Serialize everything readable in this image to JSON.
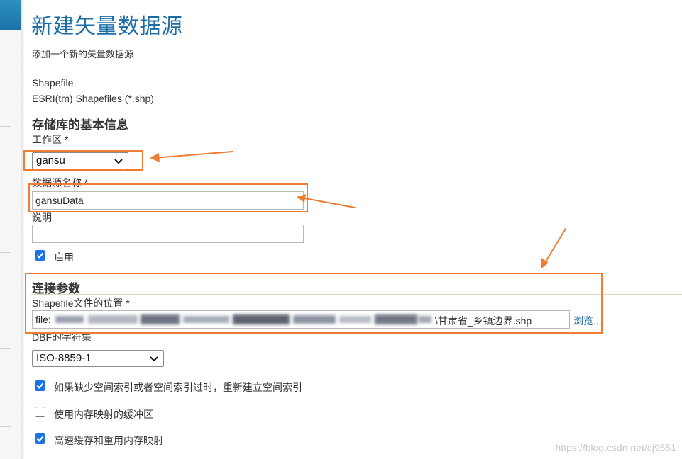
{
  "page": {
    "title": "新建矢量数据源",
    "subtitle": "添加一个新的矢量数据源"
  },
  "datasource_type": {
    "name": "Shapefile",
    "description": "ESRI(tm) Shapefiles (*.shp)"
  },
  "basic_info": {
    "section_title": "存储库的基本信息",
    "workspace_label": "工作区 *",
    "workspace_value": "gansu",
    "datasource_name_label": "数据源名称 *",
    "datasource_name_value": "gansuData",
    "description_label": "说明",
    "description_value": "",
    "enabled_label": "启用",
    "enabled": true
  },
  "connection": {
    "section_title": "连接参数",
    "shapefile_location_label": "Shapefile文件的位置 *",
    "shapefile_location_prefix": "file:",
    "shapefile_location_suffix": "\\甘肃省_乡镇边界.shp",
    "browse_label": "浏览...",
    "charset_label": "DBF的字符集",
    "charset_value": "ISO-8859-1",
    "options": [
      {
        "label": "如果缺少空间索引或者空间索引过时，重新建立空间索引",
        "checked": true
      },
      {
        "label": "使用内存映射的缓冲区",
        "checked": false
      },
      {
        "label": "高速缓存和重用内存映射",
        "checked": true
      }
    ]
  },
  "annotation": {
    "highlight_color": "#ef7d31"
  },
  "watermark": "https://blog.csdn.net/cj9551"
}
